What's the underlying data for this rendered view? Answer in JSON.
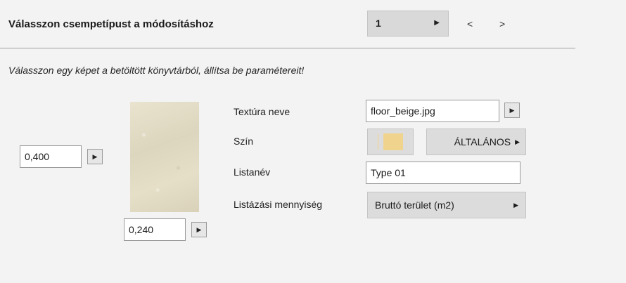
{
  "header": {
    "title": "Válasszon csempetípust a módosításhoz",
    "page_value": "1",
    "dropdown_arrow": "▶",
    "prev_label": "<",
    "next_label": ">"
  },
  "subtitle": "Válasszon egy képet a betöltött könyvtárból, állítsa be paramétereit!",
  "dimensions": {
    "height_value": "0,400",
    "width_value": "0,240",
    "button_glyph": "▶"
  },
  "form": {
    "texture_label": "Textúra neve",
    "texture_value": "floor_beige.jpg",
    "color_label": "Szín",
    "color_swatch": "#f0d48e",
    "color_mode_label": "ÁLTALÁNOS",
    "list_name_label": "Listanév",
    "list_name_value": "Type 01",
    "list_quantity_label": "Listázási mennyiség",
    "list_quantity_value": "Bruttó terület (m2)",
    "arrow_glyph": "▶"
  }
}
